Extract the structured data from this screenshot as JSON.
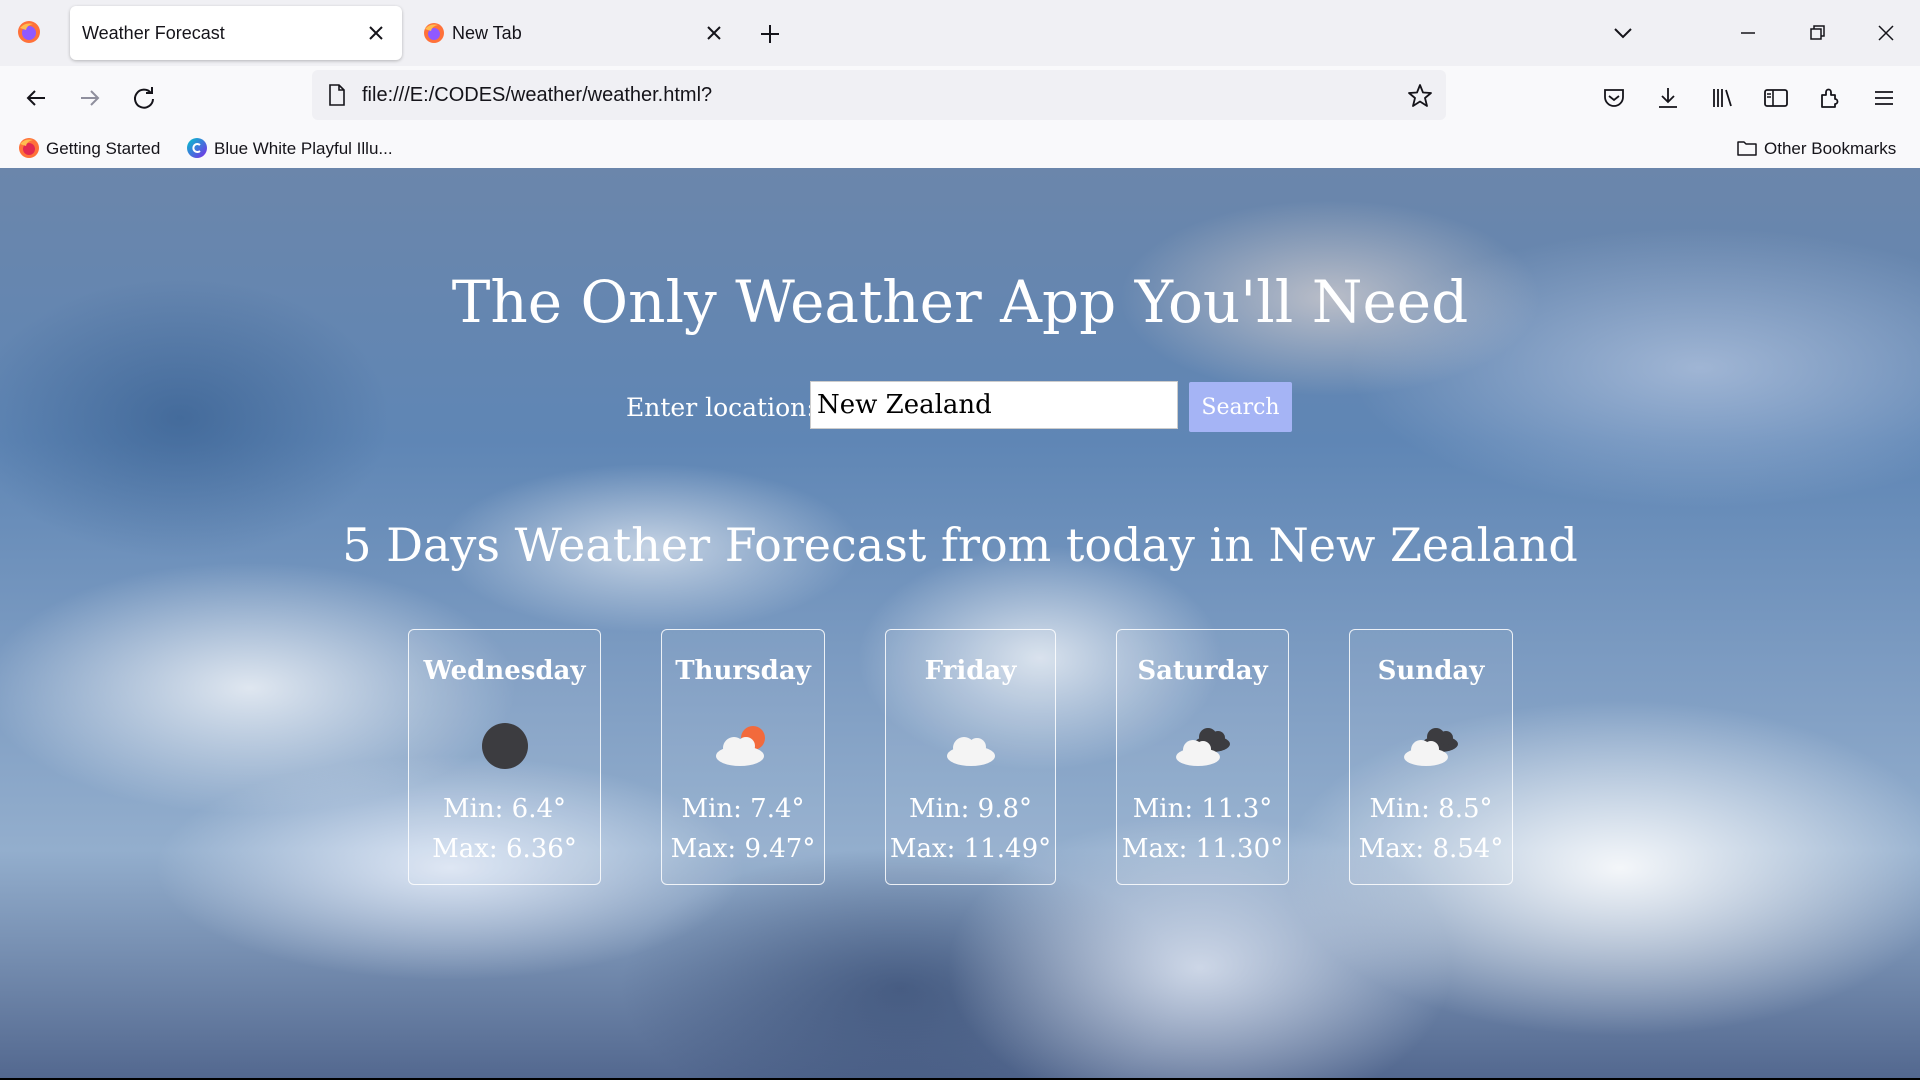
{
  "browser": {
    "tabs": [
      {
        "title": "Weather Forecast",
        "active": true
      },
      {
        "title": "New Tab",
        "active": false
      }
    ],
    "url": "file:///E:/CODES/weather/weather.html?",
    "bookmarks": [
      {
        "label": "Getting Started",
        "icon": "firefox-icon"
      },
      {
        "label": "Blue White Playful Illu...",
        "icon": "canva-icon"
      }
    ],
    "other_bookmarks": "Other Bookmarks"
  },
  "page": {
    "title": "The Only Weather App You'll Need",
    "location_label": "Enter location:",
    "location_value": "New Zealand",
    "search_label": "Search",
    "forecast_heading": "5 Days Weather Forecast from today in New Zealand",
    "days": [
      {
        "day": "Wednesday",
        "icon": "dark-moon-icon",
        "min": "Min: 6.4°",
        "max": "Max: 6.36°"
      },
      {
        "day": "Thursday",
        "icon": "sun-behind-cloud-icon",
        "min": "Min: 7.4°",
        "max": "Max: 9.47°"
      },
      {
        "day": "Friday",
        "icon": "cloud-icon",
        "min": "Min: 9.8°",
        "max": "Max: 11.49°"
      },
      {
        "day": "Saturday",
        "icon": "broken-clouds-icon",
        "min": "Min: 11.3°",
        "max": "Max: 11.30°"
      },
      {
        "day": "Sunday",
        "icon": "broken-clouds-icon",
        "min": "Min: 8.5°",
        "max": "Max: 8.54°"
      }
    ]
  },
  "colors": {
    "search_button": "#a5b4f5",
    "tabbar": "#f0f0f4",
    "toolbar": "#f9f9fb"
  }
}
